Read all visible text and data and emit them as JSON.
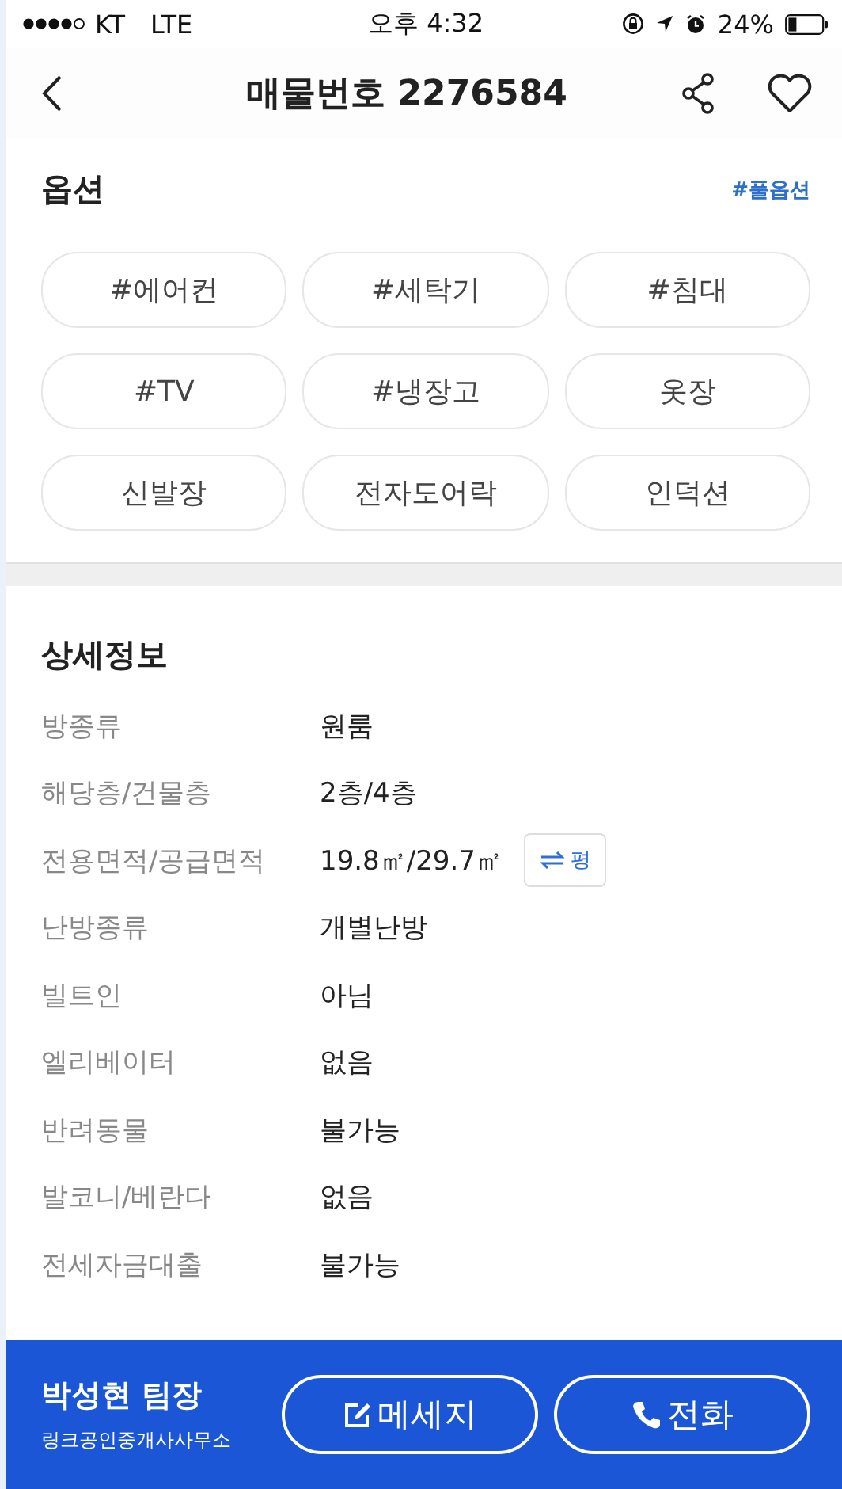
{
  "status_bar": {
    "carrier": "KT",
    "network": "LTE",
    "time": "오후 4:32",
    "battery": "24%"
  },
  "header": {
    "title": "매물번호 2276584"
  },
  "options": {
    "title": "옵션",
    "link": "#풀옵션",
    "tags": [
      "#에어컨",
      "#세탁기",
      "#침대",
      "#TV",
      "#냉장고",
      "옷장",
      "신발장",
      "전자도어락",
      "인덕션"
    ]
  },
  "details": {
    "title": "상세정보",
    "rows": [
      {
        "label": "방종류",
        "value": "원룸"
      },
      {
        "label": "해당층/건물층",
        "value": "2층/4층"
      },
      {
        "label": "전용면적/공급면적",
        "value": "19.8㎡/29.7㎡",
        "unit_button": "평"
      },
      {
        "label": "난방종류",
        "value": "개별난방"
      },
      {
        "label": "빌트인",
        "value": "아님"
      },
      {
        "label": "엘리베이터",
        "value": "없음"
      },
      {
        "label": "반려동물",
        "value": "불가능"
      },
      {
        "label": "발코니/베란다",
        "value": "없음"
      },
      {
        "label": "전세자금대출",
        "value": "불가능"
      }
    ]
  },
  "agent": {
    "name": "박성현 팀장",
    "office": "링크공인중개사사무소",
    "buttons": [
      {
        "kind": "message",
        "label": "메세지"
      },
      {
        "kind": "call",
        "label": "전화"
      }
    ]
  }
}
